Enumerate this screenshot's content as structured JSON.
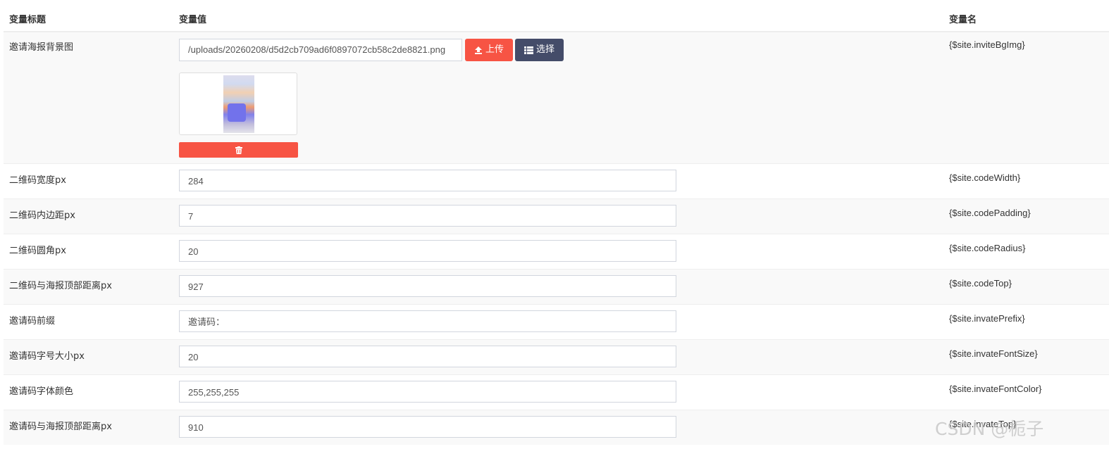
{
  "header": {
    "col_title": "变量标题",
    "col_value": "变量值",
    "col_name": "变量名"
  },
  "image_row": {
    "title": "邀请海报背景图",
    "path": "/uploads/20260208/d5d2cb709ad6f0897072cb58c2de8821.png",
    "upload_label": "上传",
    "choose_label": "选择",
    "var": "{$site.inviteBgImg}"
  },
  "rows": [
    {
      "title": "二维码宽度px",
      "value": "284",
      "var": "{$site.codeWidth}"
    },
    {
      "title": "二维码内边距px",
      "value": "7",
      "var": "{$site.codePadding}"
    },
    {
      "title": "二维码圆角px",
      "value": "20",
      "var": "{$site.codeRadius}"
    },
    {
      "title": "二维码与海报顶部距离px",
      "value": "927",
      "var": "{$site.codeTop}"
    },
    {
      "title": "邀请码前缀",
      "value": "邀请码：",
      "var": "{$site.invatePrefix}"
    },
    {
      "title": "邀请码字号大小px",
      "value": "20",
      "var": "{$site.invateFontSize}"
    },
    {
      "title": "邀请码字体颜色",
      "value": "255,255,255",
      "var": "{$site.invateFontColor}"
    },
    {
      "title": "邀请码与海报顶部距离px",
      "value": "910",
      "var": "{$site.invateTop}"
    }
  ],
  "watermark": "CSDN @栀子",
  "colors": {
    "upload": "#f75444",
    "choose": "#444c69",
    "delete": "#f75444",
    "stripe": "#f9f9f9"
  },
  "icons": {
    "upload": "upload-icon",
    "choose": "list-icon",
    "delete": "trash-icon"
  }
}
